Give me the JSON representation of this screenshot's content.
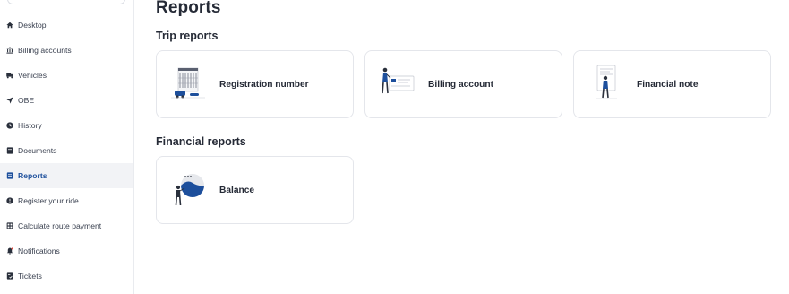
{
  "sidebar": {
    "items": [
      {
        "label": "Desktop",
        "icon": "home-icon",
        "active": false
      },
      {
        "label": "Billing accounts",
        "icon": "bank-icon",
        "active": false
      },
      {
        "label": "Vehicles",
        "icon": "truck-icon",
        "active": false
      },
      {
        "label": "OBE",
        "icon": "location-arrow-icon",
        "active": false
      },
      {
        "label": "History",
        "icon": "clock-icon",
        "active": false
      },
      {
        "label": "Documents",
        "icon": "document-icon",
        "active": false
      },
      {
        "label": "Reports",
        "icon": "report-icon",
        "active": true
      },
      {
        "label": "Register your ride",
        "icon": "alert-circle-icon",
        "active": false
      },
      {
        "label": "Calculate route payment",
        "icon": "calculator-icon",
        "active": false
      },
      {
        "label": "Notifications",
        "icon": "bell-icon",
        "active": false
      },
      {
        "label": "Tickets",
        "icon": "ticket-icon",
        "active": false
      }
    ]
  },
  "main": {
    "title": "Reports",
    "sections": [
      {
        "title": "Trip reports",
        "cards": [
          {
            "label": "Registration number",
            "illustration": "parking-building-illustration"
          },
          {
            "label": "Billing account",
            "illustration": "person-billing-card-illustration"
          },
          {
            "label": "Financial note",
            "illustration": "person-document-illustration"
          }
        ]
      },
      {
        "title": "Financial reports",
        "cards": [
          {
            "label": "Balance",
            "illustration": "person-pie-chart-illustration"
          }
        ]
      }
    ]
  },
  "colors": {
    "accent": "#1d4f9c",
    "text": "#252a36",
    "border": "#e4e6eb",
    "active_bg": "#f2f3f6"
  }
}
